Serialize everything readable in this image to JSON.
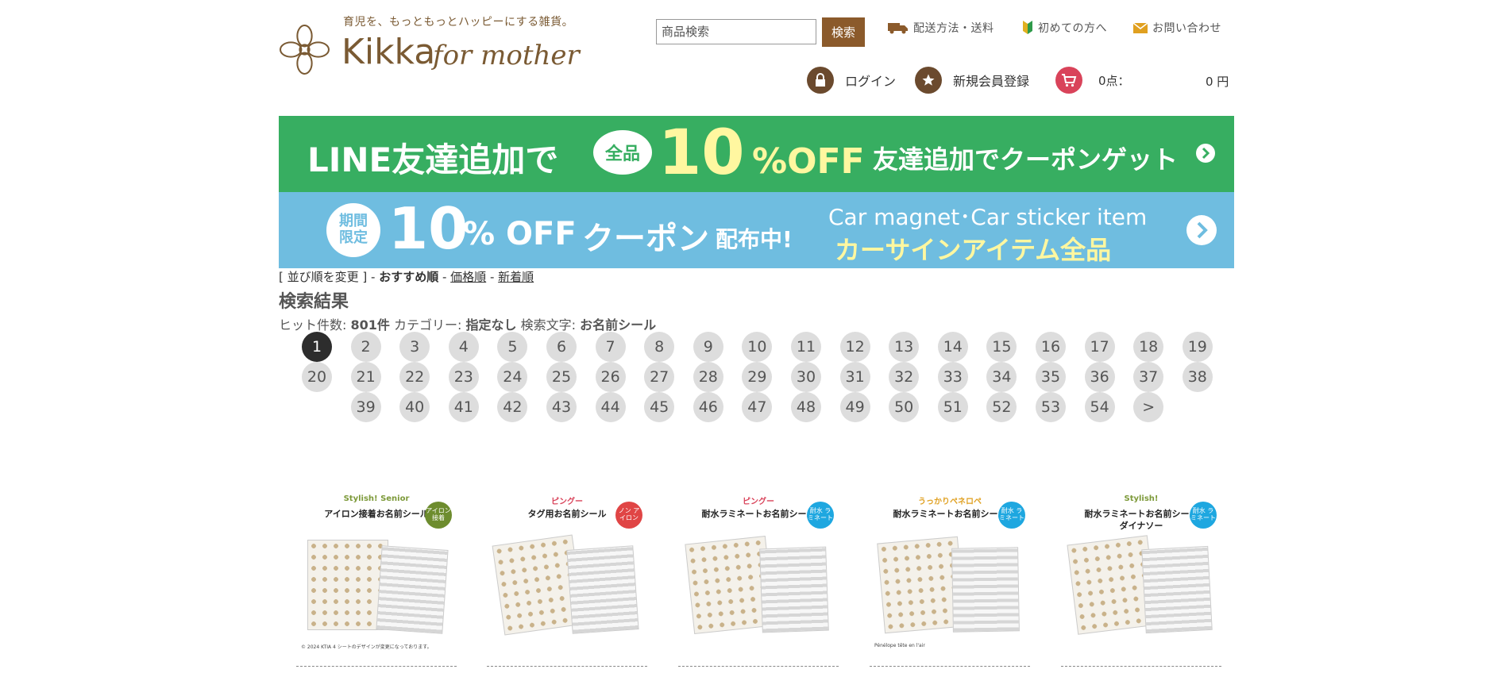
{
  "header": {
    "tagline": "育児を、もっともっとハッピーにする雑貨。",
    "logo_main": "Kikka",
    "logo_sub": "for mother",
    "search": {
      "placeholder": "商品検索",
      "button_label": "検索"
    },
    "links": [
      {
        "label": "配送方法・送料",
        "icon": "truck-icon"
      },
      {
        "label": "初めての方へ",
        "icon": "beginner-mark-icon"
      },
      {
        "label": "お問い合わせ",
        "icon": "envelope-icon"
      }
    ],
    "account": {
      "login_label": "ログイン",
      "register_label": "新規会員登録",
      "cart_count": "0点：",
      "cart_total": "0 円"
    },
    "colors": {
      "brand": "#7a5a33",
      "button": "#8b5a2b",
      "account_icon": "#6b4a2e",
      "cart_icon": "#d9435a"
    }
  },
  "banners": {
    "line": {
      "text_left": "LINE友達追加で",
      "bubble": "全品",
      "big": "10",
      "pct": "%OFF",
      "text_right": "友達追加でクーポンゲット",
      "color": "#37ae61"
    },
    "car": {
      "badge_top": "期間",
      "badge_bottom": "限定",
      "big": "10",
      "pct": "% OFF",
      "coupon": "クーポン",
      "haifu": "配布中!",
      "en": "Car magnet･Car sticker item",
      "jp": "カーサインアイテム全品",
      "color": "#6fbde0"
    }
  },
  "sort": {
    "prefix": "[ 並び順を変更 ]",
    "sep": " - ",
    "current": "おすすめ順",
    "price": "価格順",
    "newest": "新着順"
  },
  "results": {
    "title": "検索結果",
    "hits_label": "ヒット件数:",
    "hits_value": "801件",
    "category_label": "カテゴリー:",
    "category_value": "指定なし",
    "keyword_label": "検索文字:",
    "keyword_value": "お名前シール"
  },
  "pagination": {
    "current": 1,
    "last": 54,
    "next_label": ">"
  },
  "products": [
    {
      "brand": "Stylish! Senior",
      "brand_color": "#7d9a3a",
      "title": "アイロン接着お名前シール",
      "title2": "",
      "badge": "アイロン接着",
      "badge_color": "#6d8c2e",
      "foot": "© 2024 KTIA 4 シートのデザインが変更になっております。"
    },
    {
      "brand": "ピングー",
      "brand_color": "#d9435a",
      "title": "タグ用お名前シール",
      "title2": "",
      "badge": "ノン アイロン",
      "badge_color": "#e04545",
      "foot": ""
    },
    {
      "brand": "ピングー",
      "brand_color": "#d9435a",
      "title": "耐水ラミネートお名前シール",
      "title2": "",
      "badge": "耐水 ラミネート",
      "badge_color": "#1ea7e0",
      "foot": ""
    },
    {
      "brand": "うっかりペネロペ",
      "brand_color": "#e0a020",
      "title": "耐水ラミネートお名前シール",
      "title2": "",
      "badge": "耐水 ラミネート",
      "badge_color": "#1ea7e0",
      "foot": "Pénélope tête en l'air"
    },
    {
      "brand": "Stylish!",
      "brand_color": "#7d9a3a",
      "title": "耐水ラミネートお名前シール",
      "title2": "ダイナソー",
      "badge": "耐水 ラミネート",
      "badge_color": "#1ea7e0",
      "foot": ""
    }
  ]
}
